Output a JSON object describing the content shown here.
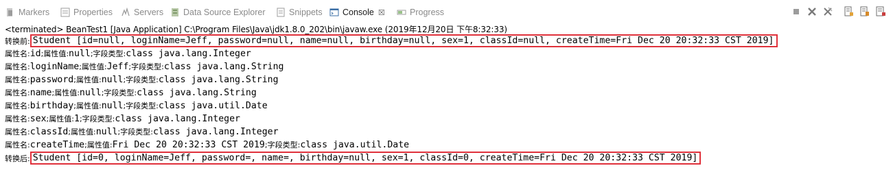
{
  "tabs": [
    {
      "label": "Markers",
      "icon": "markers-icon",
      "active": false
    },
    {
      "label": "Properties",
      "icon": "properties-icon",
      "active": false
    },
    {
      "label": "Servers",
      "icon": "servers-icon",
      "active": false
    },
    {
      "label": "Data Source Explorer",
      "icon": "data-source-icon",
      "active": false
    },
    {
      "label": "Snippets",
      "icon": "snippets-icon",
      "active": false
    },
    {
      "label": "Console",
      "icon": "console-icon",
      "active": true,
      "close": "☒"
    },
    {
      "label": "Progress",
      "icon": "progress-icon",
      "active": false
    }
  ],
  "toolbar_icons": [
    "terminate-icon",
    "remove-launch-icon",
    "remove-all-icon",
    "scroll-lock-icon",
    "word-wrap-icon",
    "pin-console-icon"
  ],
  "status": "<terminated> BeanTest1 [Java Application] C:\\Program Files\\Java\\jdk1.8.0_202\\bin\\javaw.exe (2019年12月20日 下午8:32:33)",
  "console": {
    "before": {
      "prefix": "转换前:",
      "text": "Student [id=null, loginName=Jeff, password=null, name=null, birthday=null, sex=1, classId=null, createTime=Fri Dec 20 20:32:33 CST 2019]"
    },
    "fields": [
      {
        "name": "id",
        "value": "null",
        "type": "class java.lang.Integer"
      },
      {
        "name": "loginName",
        "value": "Jeff",
        "type": "class java.lang.String"
      },
      {
        "name": "password",
        "value": "null",
        "type": "class java.lang.String"
      },
      {
        "name": "name",
        "value": "null",
        "type": "class java.lang.String"
      },
      {
        "name": "birthday",
        "value": "null",
        "type": "class java.util.Date"
      },
      {
        "name": "sex",
        "value": "1",
        "type": "class java.lang.Integer"
      },
      {
        "name": "classId",
        "value": "null",
        "type": "class java.lang.Integer"
      },
      {
        "name": "createTime",
        "value": "Fri Dec 20 20:32:33 CST 2019",
        "type": "class java.util.Date"
      }
    ],
    "labels": {
      "field_name": "属性名:",
      "field_value": "属性值:",
      "field_type": "字段类型:",
      "semicolon": ";"
    },
    "after": {
      "prefix": "转换后:",
      "text": "Student [id=0, loginName=Jeff, password=, name=, birthday=null, sex=1, classId=0, createTime=Fri Dec 20 20:32:33 CST 2019]"
    }
  },
  "colors": {
    "highlight_border": "#e0313b",
    "inactive_tab": "#8a8a8a"
  }
}
